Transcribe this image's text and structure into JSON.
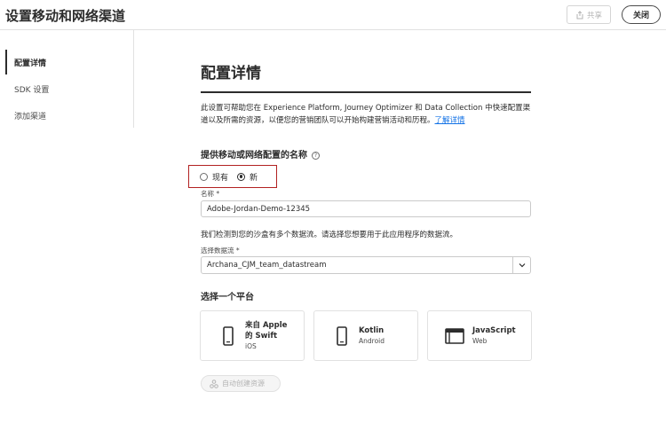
{
  "header": {
    "title": "设置移动和网络渠道",
    "share_label": "共享",
    "close_label": "关闭"
  },
  "sidebar": {
    "items": [
      {
        "label": "配置详情",
        "active": true
      },
      {
        "label": "SDK 设置",
        "active": false
      },
      {
        "label": "添加渠道",
        "active": false
      }
    ]
  },
  "main": {
    "title": "配置详情",
    "intro": "此设置可帮助您在 Experience Platform, Journey Optimizer 和 Data Collection 中快速配置渠道以及所需的资源，以便您的营销团队可以开始构建营销活动和历程。",
    "learn_more": "了解详情",
    "name_heading": "提供移动或网络配置的名称",
    "help_icon": "?",
    "radio_existing": "现有",
    "radio_new": "新",
    "radio_selected": "新",
    "name_label": "名称",
    "required_mark": "*",
    "name_value": "Adobe-Jordan-Demo-12345",
    "datastream_note": "我们检测到您的沙盒有多个数据流。请选择您想要用于此应用程序的数据流。",
    "datastream_label": "选择数据流",
    "datastream_value": "Archana_CJM_team_datastream",
    "platform_heading": "选择一个平台",
    "platforms": [
      {
        "title": "来自 Apple 的 Swift",
        "subtitle": "iOS",
        "icon": "phone-icon"
      },
      {
        "title": "Kotlin",
        "subtitle": "Android",
        "icon": "phone-icon"
      },
      {
        "title": "JavaScript",
        "subtitle": "Web",
        "icon": "browser-icon"
      }
    ],
    "auto_create_label": "自动创建资源"
  }
}
